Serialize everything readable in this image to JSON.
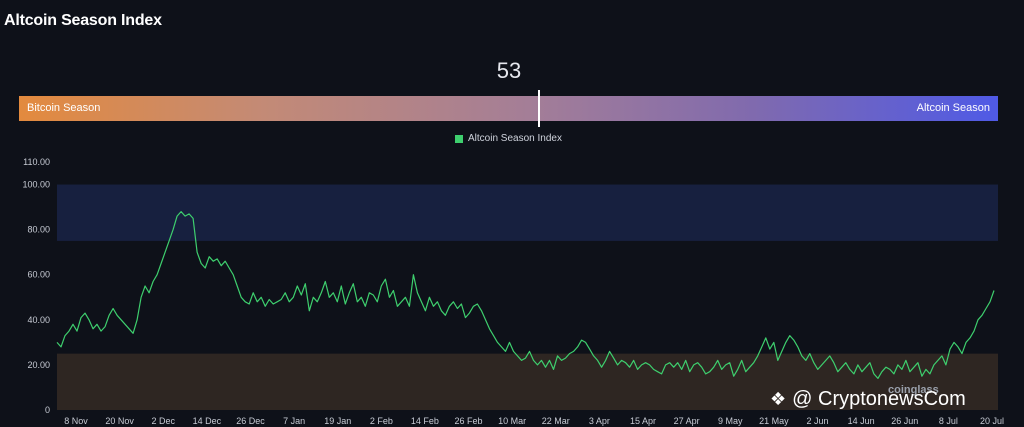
{
  "title": "Altcoin Season Index",
  "score": "53",
  "bar": {
    "left_label": "Bitcoin Season",
    "right_label": "Altcoin Season",
    "marker_value": 53
  },
  "colors": {
    "line": "#3ecf6e",
    "altcoin_zone": "#17203f",
    "bitcoin_zone": "#2e2622",
    "background": "#0e1119"
  },
  "watermark": {
    "brand": "@ CryptonewsCom",
    "icon": "diamond-logo-icon",
    "coinglass": "coinglass"
  },
  "chart_data": {
    "type": "line",
    "series": [
      {
        "name": "Altcoin Season Index",
        "values": [
          30,
          28,
          33,
          35,
          38,
          35,
          41,
          43,
          40,
          36,
          38,
          35,
          37,
          42,
          45,
          42,
          40,
          38,
          36,
          34,
          40,
          50,
          55,
          52,
          57,
          60,
          65,
          70,
          75,
          80,
          86,
          88,
          86,
          87,
          85,
          70,
          65,
          63,
          68,
          66,
          67,
          64,
          66,
          63,
          60,
          55,
          50,
          48,
          47,
          52,
          48,
          50,
          46,
          49,
          47,
          48,
          49,
          52,
          48,
          50,
          55,
          51,
          56,
          44,
          50,
          48,
          52,
          57,
          50,
          52,
          48,
          55,
          47,
          52,
          56,
          48,
          50,
          46,
          52,
          51,
          48,
          55,
          58,
          50,
          53,
          46,
          48,
          50,
          46,
          60,
          52,
          48,
          44,
          50,
          46,
          48,
          44,
          42,
          46,
          48,
          45,
          47,
          41,
          43,
          46,
          47,
          44,
          40,
          36,
          33,
          30,
          28,
          26,
          30,
          26,
          24,
          22,
          23,
          26,
          22,
          20,
          22,
          19,
          22,
          18,
          24,
          22,
          23,
          25,
          26,
          28,
          31,
          30,
          27,
          24,
          22,
          19,
          22,
          26,
          23,
          20,
          22,
          21,
          19,
          22,
          18,
          20,
          21,
          20,
          18,
          17,
          16,
          20,
          21,
          19,
          21,
          18,
          22,
          17,
          20,
          21,
          19,
          16,
          17,
          19,
          22,
          18,
          20,
          21,
          15,
          18,
          22,
          17,
          19,
          21,
          24,
          28,
          32,
          27,
          30,
          22,
          26,
          30,
          33,
          31,
          28,
          24,
          22,
          25,
          21,
          18,
          20,
          22,
          24,
          21,
          17,
          19,
          21,
          18,
          16,
          20,
          17,
          19,
          21,
          16,
          14,
          17,
          19,
          18,
          16,
          20,
          18,
          22,
          17,
          19,
          21,
          15,
          18,
          16,
          20,
          22,
          24,
          20,
          27,
          30,
          28,
          25,
          30,
          32,
          35,
          40,
          42,
          45,
          48,
          53
        ]
      }
    ],
    "x_ticks": [
      "8 Nov",
      "20 Nov",
      "2 Dec",
      "14 Dec",
      "26 Dec",
      "7 Jan",
      "19 Jan",
      "2 Feb",
      "14 Feb",
      "26 Feb",
      "10 Mar",
      "22 Mar",
      "3 Apr",
      "15 Apr",
      "27 Apr",
      "9 May",
      "21 May",
      "2 Jun",
      "14 Jun",
      "26 Jun",
      "8 Jul",
      "20 Jul"
    ],
    "y_ticks": [
      "0",
      "20.00",
      "40.00",
      "60.00",
      "80.00",
      "100.00",
      "110.00"
    ],
    "ylim": [
      0,
      110
    ],
    "bands": [
      {
        "from": 75,
        "to": 100,
        "label": "Altcoin Season zone"
      },
      {
        "from": 0,
        "to": 25,
        "label": "Bitcoin Season zone"
      }
    ],
    "legend": "top-center",
    "grid": false
  }
}
